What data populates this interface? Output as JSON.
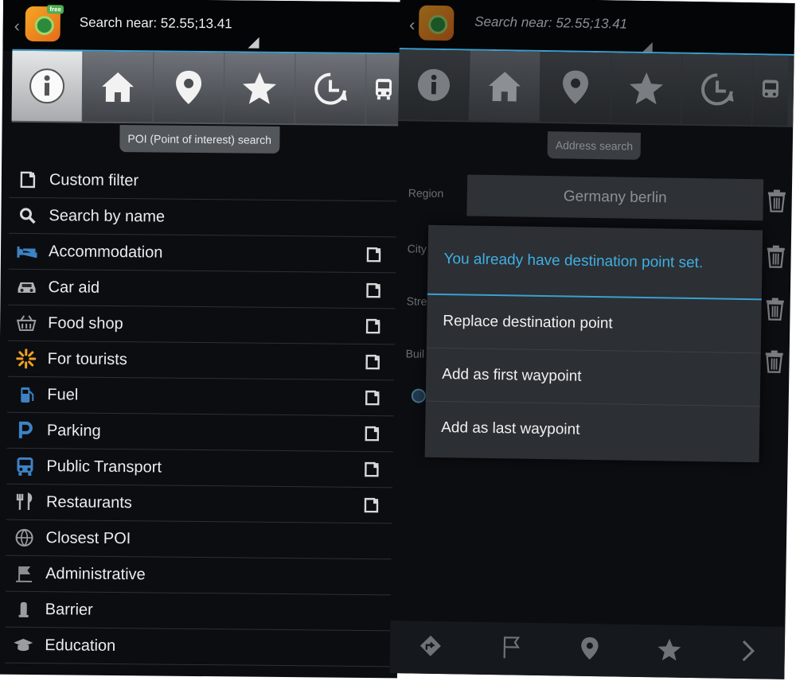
{
  "left": {
    "header": {
      "search_near": "Search near: 52.55;13.41",
      "logo_badge": "free"
    },
    "tabs": [
      {
        "name": "info",
        "icon": "info-icon",
        "active": true
      },
      {
        "name": "home",
        "icon": "home-icon"
      },
      {
        "name": "location",
        "icon": "location-pin-icon"
      },
      {
        "name": "favorites",
        "icon": "star-icon"
      },
      {
        "name": "history",
        "icon": "history-icon"
      },
      {
        "name": "transport",
        "icon": "bus-icon"
      }
    ],
    "tooltip": "POI (Point of interest) search",
    "menu": [
      {
        "label": "Custom filter",
        "icon": "filter-icon",
        "sub": false
      },
      {
        "label": "Search by name",
        "icon": "search-icon",
        "sub": false
      },
      {
        "label": "Accommodation",
        "icon": "bed-icon",
        "sub": true
      },
      {
        "label": "Car aid",
        "icon": "car-icon",
        "sub": true
      },
      {
        "label": "Food shop",
        "icon": "basket-icon",
        "sub": true
      },
      {
        "label": "For tourists",
        "icon": "sunburst-icon",
        "sub": true
      },
      {
        "label": "Fuel",
        "icon": "fuel-icon",
        "sub": true
      },
      {
        "label": "Parking",
        "icon": "parking-icon",
        "sub": true
      },
      {
        "label": "Public Transport",
        "icon": "bus-icon",
        "sub": true
      },
      {
        "label": "Restaurants",
        "icon": "cutlery-icon",
        "sub": true
      },
      {
        "label": "Closest POI",
        "icon": "globe-icon",
        "sub": false
      },
      {
        "label": "Administrative",
        "icon": "flag-icon",
        "sub": false
      },
      {
        "label": "Barrier",
        "icon": "barrier-icon",
        "sub": false
      },
      {
        "label": "Education",
        "icon": "graduation-cap-icon",
        "sub": false
      }
    ]
  },
  "right": {
    "header": {
      "search_near": "Search near: 52.55;13.41"
    },
    "tooltip": "Address search",
    "form": [
      {
        "label": "Region",
        "value": "Germany berlin"
      },
      {
        "label": "City",
        "value": ""
      },
      {
        "label": "Stre",
        "value": ""
      },
      {
        "label": "Buil",
        "value": ""
      }
    ],
    "dialog": {
      "title": "You already have destination point set.",
      "options": [
        "Replace destination point",
        "Add as first waypoint",
        "Add as last waypoint"
      ]
    },
    "bottom_bar": [
      "directions-icon",
      "flag-icon",
      "location-pin-icon",
      "star-icon",
      "chevron-right-icon"
    ]
  },
  "colors": {
    "accent": "#3aa0d0",
    "dialog_title": "#3fb0e2",
    "background": "#0b0d11"
  }
}
